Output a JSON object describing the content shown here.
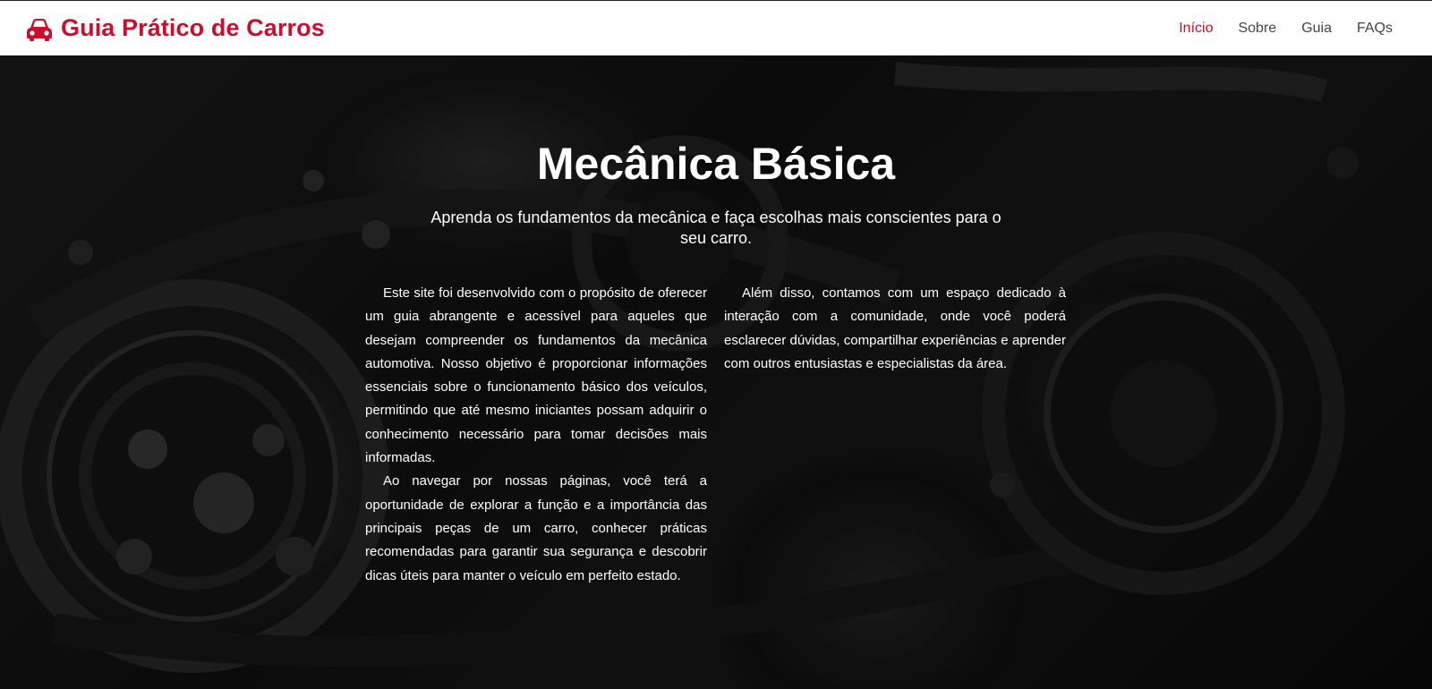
{
  "navbar": {
    "brand": "Guia Prático de Carros",
    "links": [
      {
        "label": "Início",
        "active": true
      },
      {
        "label": "Sobre",
        "active": false
      },
      {
        "label": "Guia",
        "active": false
      },
      {
        "label": "FAQs",
        "active": false
      }
    ]
  },
  "hero": {
    "title": "Mecânica Básica",
    "subtitle": "Aprenda os fundamentos da mecânica e faça escolhas mais conscientes para o seu carro.",
    "left_column": [
      "Este site foi desenvolvido com o propósito de oferecer um guia abrangente e acessível para aqueles que desejam compreender os fundamentos da mecânica automotiva. Nosso objetivo é proporcionar informações essenciais sobre o funcionamento básico dos veículos, permitindo que até mesmo iniciantes possam adquirir o conhecimento necessário para tomar decisões mais informadas.",
      "Ao navegar por nossas páginas, você terá a oportunidade de explorar a função e a importância das principais peças de um carro, conhecer práticas recomendadas para garantir sua segurança e descobrir dicas úteis para manter o veículo em perfeito estado."
    ],
    "right_column": [
      "Além disso, contamos com um espaço dedicado à interação com a comunidade, onde você poderá esclarecer dúvidas, compartilhar experiências e aprender com outros entusiastas e especialistas da área."
    ]
  },
  "colors": {
    "brand": "#c8102e",
    "nav_text": "#444444",
    "hero_text": "#ffffff"
  },
  "icons": {
    "brand_icon": "car-icon"
  }
}
